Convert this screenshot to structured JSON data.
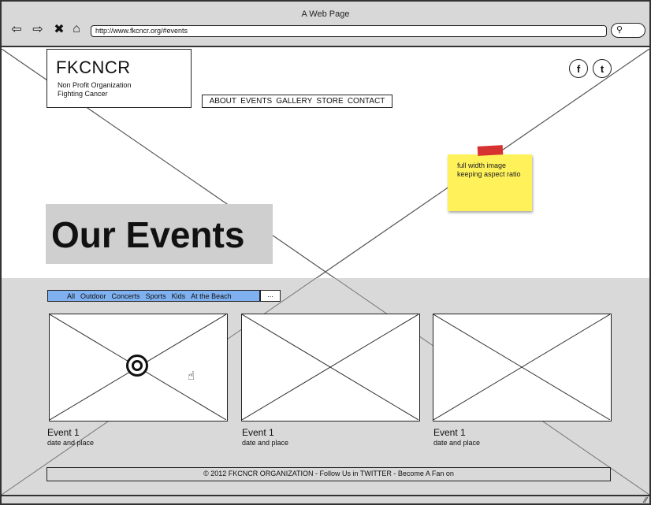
{
  "window": {
    "title": "A Web Page",
    "url": "http://www.fkcncr.org/#events"
  },
  "brand": {
    "name": "FKCNCR",
    "tagline_line1": "Non Profit Organization",
    "tagline_line2": "Fighting Cancer"
  },
  "nav": [
    "ABOUT",
    "EVENTS",
    "GALLERY",
    "STORE",
    "CONTACT"
  ],
  "social": {
    "facebook": "f",
    "twitter": "t"
  },
  "note": {
    "line1": "full width image",
    "line2": "keeping aspect ratio"
  },
  "hero": {
    "heading": "Our Events"
  },
  "filters": {
    "items": [
      "All",
      "Outdoor",
      "Concerts",
      "Sports",
      "Kids",
      "At the Beach"
    ],
    "more": "..."
  },
  "events": [
    {
      "title": "Event 1",
      "subtitle": "date and place"
    },
    {
      "title": "Event 1",
      "subtitle": "date and place"
    },
    {
      "title": "Event 1",
      "subtitle": "date and place"
    }
  ],
  "footer": {
    "text": "© 2012 FKCNCR ORGANIZATION - Follow Us in TWITTER - Become A Fan on"
  },
  "colors": {
    "filter_bar": "#7fb0f0",
    "sticky_note": "#fff15a",
    "sticky_tape": "#d63330",
    "lower_bg": "#d9d9d9",
    "chrome_bg": "#d8d8d8"
  },
  "icons": [
    "back-arrow-icon",
    "forward-arrow-icon",
    "stop-icon",
    "home-icon",
    "search-icon",
    "facebook-icon",
    "twitter-icon",
    "loading-spinner-icon",
    "hand-cursor-icon",
    "resize-grip-icon"
  ]
}
